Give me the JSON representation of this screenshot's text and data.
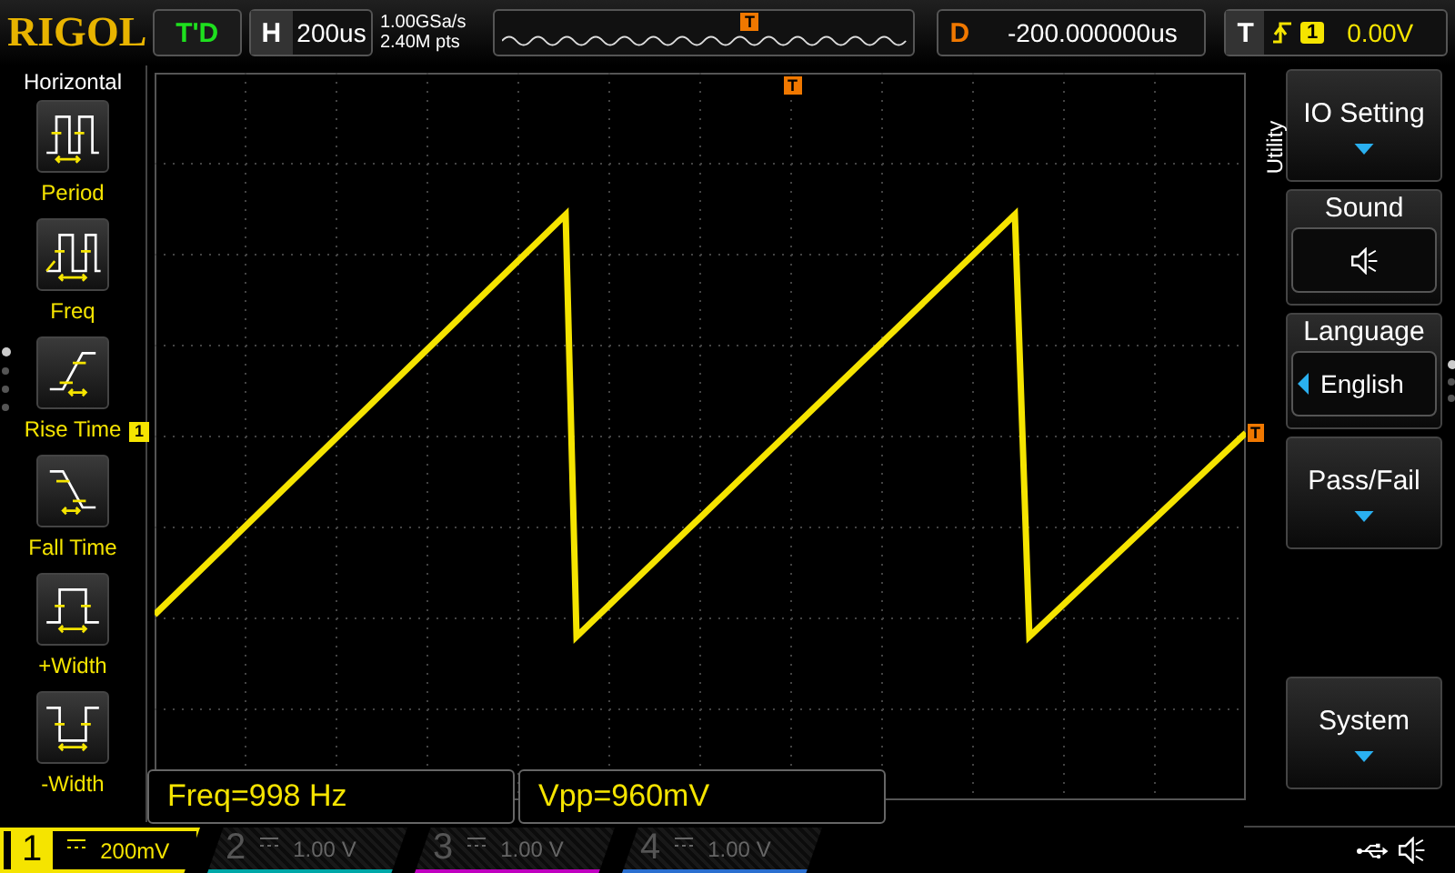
{
  "brand": "RIGOL",
  "run_status": "T'D",
  "timebase": {
    "label": "H",
    "value": "200us"
  },
  "acquisition": {
    "sample_rate": "1.00GSa/s",
    "memory_depth": "2.40M pts"
  },
  "memory_bar": {
    "trigger_marker": "T"
  },
  "delay": {
    "label": "D",
    "value": "-200.000000us"
  },
  "trigger": {
    "label": "T",
    "source": "1",
    "reading": "0.00V"
  },
  "left_menu": {
    "title": "Horizontal",
    "items": [
      {
        "kind": "period",
        "label": "Period"
      },
      {
        "kind": "freq",
        "label": "Freq"
      },
      {
        "kind": "rise",
        "label": "Rise Time"
      },
      {
        "kind": "fall",
        "label": "Fall Time"
      },
      {
        "kind": "pwidth",
        "label": "+Width"
      },
      {
        "kind": "nwidth",
        "label": "-Width"
      }
    ],
    "page_dots": [
      {
        "selected": true
      },
      {
        "selected": false
      },
      {
        "selected": false
      },
      {
        "selected": false
      }
    ]
  },
  "graticule": {
    "channel_marker": "1",
    "trigger_position_marker": "T",
    "trigger_level_marker": "T"
  },
  "measurements": [
    "Freq=998 Hz",
    "Vpp=960mV"
  ],
  "right_menu": {
    "title": "Utility",
    "items": [
      {
        "kind": "submenu",
        "label": "IO Setting"
      },
      {
        "kind": "sound",
        "label": "Sound"
      },
      {
        "kind": "option",
        "label": "Language",
        "value": "English"
      },
      {
        "kind": "submenu",
        "label": "Pass/Fail"
      },
      {
        "kind": "empty"
      },
      {
        "kind": "submenu",
        "label": "System"
      }
    ],
    "page_dots": [
      {
        "selected": true
      },
      {
        "selected": false
      },
      {
        "selected": false
      }
    ]
  },
  "channels": [
    {
      "number": "1",
      "scale": "200mV",
      "color": "#f5e400",
      "selected": true
    },
    {
      "number": "2",
      "scale": "1.00 V",
      "color": "#00a8a8",
      "selected": false
    },
    {
      "number": "3",
      "scale": "1.00 V",
      "color": "#c000c0",
      "selected": false
    },
    {
      "number": "4",
      "scale": "1.00 V",
      "color": "#2a6fd0",
      "selected": false
    }
  ]
}
